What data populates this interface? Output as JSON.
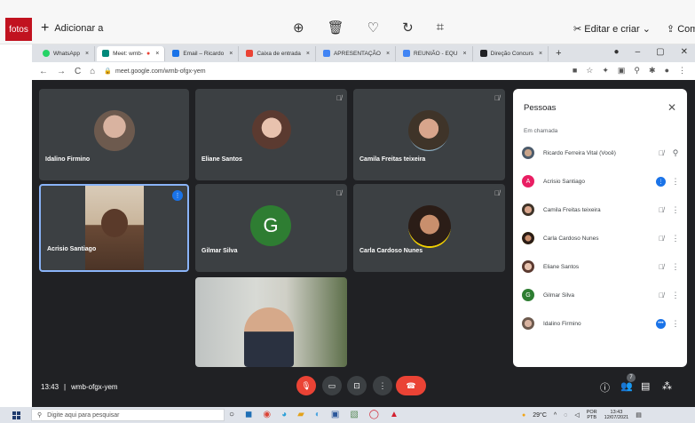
{
  "photos_bar": {
    "app_tag": "fotos",
    "add_label": "Adicionar a",
    "edit_label": "Editar e criar",
    "share_label": "Compar"
  },
  "chrome": {
    "tabs": [
      {
        "label": "WhatsApp",
        "color": "#25d366"
      },
      {
        "label": "Meet: wmb-",
        "color": "#00897b"
      },
      {
        "label": "Email – Ricardo",
        "color": "#1a73e8"
      },
      {
        "label": "Caixa de entrada",
        "color": "#ea4335"
      },
      {
        "label": "APRESENTAÇÃO",
        "color": "#4285f4"
      },
      {
        "label": "REUNIÃO - EQU",
        "color": "#4285f4"
      },
      {
        "label": "Direção Concurs",
        "color": "#202124"
      }
    ],
    "url": "meet.google.com/wmb-ofgx-yem"
  },
  "meet": {
    "tiles": [
      {
        "name": "Idalino Firmino"
      },
      {
        "name": "Eliane Santos"
      },
      {
        "name": "Camila Freitas teixeira"
      },
      {
        "name": "Acrisio Santiago"
      },
      {
        "name": "Gilmar Silva",
        "letter": "G"
      },
      {
        "name": "Carla Cardoso Nunes"
      }
    ],
    "meeting_time": "13:43",
    "meeting_code": "wmb-ofgx-yem",
    "participant_count": "7"
  },
  "people_panel": {
    "title": "Pessoas",
    "section": "Em chamada",
    "people": [
      {
        "name": "Ricardo Ferreira Vital (Você)"
      },
      {
        "name": "Acrisio Santiago",
        "letter": "A",
        "color": "#e91e63"
      },
      {
        "name": "Camila Freitas teixeira"
      },
      {
        "name": "Carla Cardoso Nunes"
      },
      {
        "name": "Eliane Santos"
      },
      {
        "name": "Gilmar Silva",
        "letter": "G",
        "color": "#2e7d32"
      },
      {
        "name": "Idalino Firmino"
      }
    ]
  },
  "taskbar": {
    "search_placeholder": "Digite aqui para pesquisar",
    "temperature": "29°C",
    "lang_line1": "POR",
    "lang_line2": "PTB",
    "clock_time": "13:43",
    "clock_date": "12/07/2021"
  }
}
